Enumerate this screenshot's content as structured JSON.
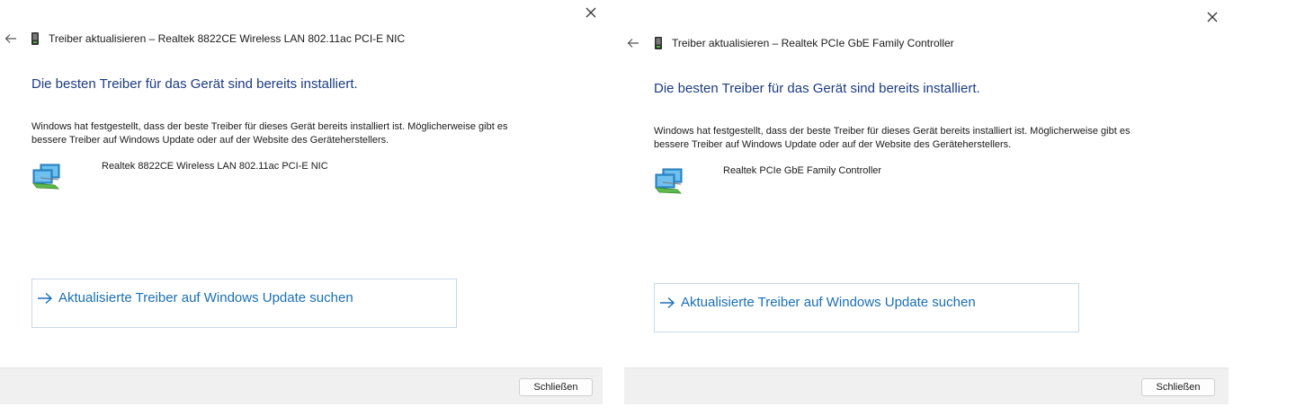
{
  "dialogs": [
    {
      "title": "Treiber aktualisieren – Realtek 8822CE Wireless LAN 802.11ac PCI-E NIC",
      "heading": "Die besten Treiber für das Gerät sind bereits installiert.",
      "description": "Windows hat festgestellt, dass der beste Treiber für dieses Gerät bereits installiert ist. Möglicherweise gibt es bessere Treiber auf Windows Update oder auf der Website des Geräteherstellers.",
      "device_name": "Realtek 8822CE Wireless LAN 802.11ac PCI-E NIC",
      "update_link": "Aktualisierte Treiber auf Windows Update suchen",
      "close_button": "Schließen"
    },
    {
      "title": "Treiber aktualisieren – Realtek PCIe GbE Family Controller",
      "heading": "Die besten Treiber für das Gerät sind bereits installiert.",
      "description": "Windows hat festgestellt, dass der beste Treiber für dieses Gerät bereits installiert ist. Möglicherweise gibt es bessere Treiber auf Windows Update oder auf der Website des Geräteherstellers.",
      "device_name": "Realtek PCIe GbE Family Controller",
      "update_link": "Aktualisierte Treiber auf Windows Update suchen",
      "close_button": "Schließen"
    }
  ],
  "icons": {
    "close": "close-icon",
    "back": "back-arrow-icon",
    "device_manager": "device-manager-icon",
    "network_adapter": "network-adapter-icon",
    "link_arrow": "arrow-right-icon"
  },
  "colors": {
    "heading": "#1c3c80",
    "link": "#1a6fb5",
    "footer": "#f0f0f0"
  }
}
